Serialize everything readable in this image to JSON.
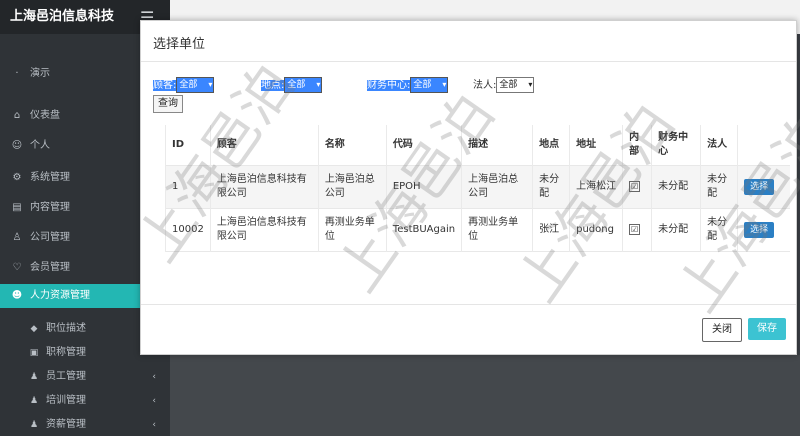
{
  "app": {
    "brand": "上海邑泊信息科技"
  },
  "sidebar": {
    "items": [
      {
        "label": "演示",
        "icon": "dot-icon"
      },
      {
        "label": "仪表盘",
        "icon": "home-icon"
      },
      {
        "label": "个人",
        "icon": "user-icon"
      },
      {
        "label": "系统管理",
        "icon": "gear-icon"
      },
      {
        "label": "内容管理",
        "icon": "doc-icon"
      },
      {
        "label": "公司管理",
        "icon": "org-icon"
      },
      {
        "label": "会员管理",
        "icon": "member-icon"
      },
      {
        "label": "人力资源管理",
        "icon": "people-icon"
      }
    ],
    "subitems": [
      {
        "label": "职位描述"
      },
      {
        "label": "职称管理"
      },
      {
        "label": "员工管理"
      },
      {
        "label": "培训管理"
      },
      {
        "label": "资薪管理"
      }
    ]
  },
  "modal": {
    "title": "选择单位",
    "filters": {
      "customer_label": "顾客:",
      "customer_value": "全部",
      "location_label": "地点:",
      "location_value": "全部",
      "finance_label": "财务中心:",
      "finance_value": "全部",
      "legal_label": "法人:",
      "legal_value": "全部"
    },
    "query_label": "查询",
    "columns": [
      "ID",
      "顾客",
      "名称",
      "代码",
      "描述",
      "地点",
      "地址",
      "内部",
      "财务中心",
      "法人",
      ""
    ],
    "rows": [
      {
        "id": "1",
        "customer": "上海邑泊信息科技有限公司",
        "name": "上海邑泊总公司",
        "code": "EPOH",
        "desc": "上海邑泊总公司",
        "location": "未分配",
        "address": "上海松江",
        "internal": "☑",
        "finance": "未分配",
        "legal": "未分配",
        "action": "选择"
      },
      {
        "id": "10002",
        "customer": "上海邑泊信息科技有限公司",
        "name": "再测业务单位",
        "code": "TestBUAgain",
        "desc": "再测业务单位",
        "location": "张江",
        "address": "pudong",
        "internal": "☑",
        "finance": "未分配",
        "legal": "未分配",
        "action": "选择"
      }
    ],
    "close_label": "关闭",
    "save_label": "保存"
  },
  "watermark": {
    "text": "上海邑泊"
  },
  "colors": {
    "accent": "#23b7b3",
    "save": "#3cc3d2",
    "choose": "#2b7fc4"
  }
}
